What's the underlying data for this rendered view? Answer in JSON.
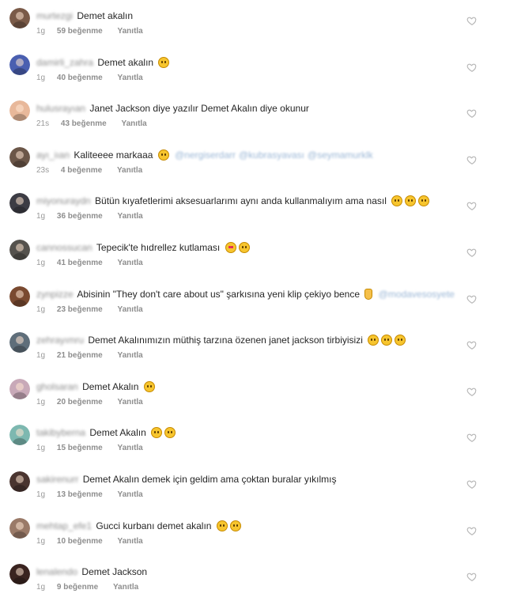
{
  "comments": [
    {
      "username": "murtezgi",
      "text": "Demet akalın",
      "emojis": [],
      "mentions": [],
      "time": "1g",
      "likes": "59 beğenme",
      "reply": "Yanıtla",
      "avatar_color": "#7a5a48"
    },
    {
      "username": "damirli_zahra",
      "text": "Demet akalın",
      "emojis": [
        "laugh"
      ],
      "mentions": [],
      "time": "1g",
      "likes": "40 beğenme",
      "reply": "Yanıtla",
      "avatar_color": "#4a5fb0"
    },
    {
      "username": "hulusrayıan",
      "text": "Janet Jackson diye yazılır Demet Akalın diye okunur",
      "emojis": [],
      "mentions": [],
      "time": "21s",
      "likes": "43 beğenme",
      "reply": "Yanıtla",
      "avatar_color": "#e8b89a"
    },
    {
      "username": "ayı_iıan",
      "text": "Kaliteeee markaaa",
      "emojis": [
        "laugh"
      ],
      "mentions": [
        "@nergiserdarr",
        "@kubrasyavası",
        "@seymamurklk"
      ],
      "time": "23s",
      "likes": "4 beğenme",
      "reply": "Yanıtla",
      "avatar_color": "#6b5648"
    },
    {
      "username": "miyonuraydn",
      "text": "Bütün kıyafetlerimi aksesuarlarımı aynı anda kullanmalıyım ama nasıl",
      "emojis": [
        "grin",
        "grin",
        "grin"
      ],
      "mentions": [],
      "time": "1g",
      "likes": "36 beğenme",
      "reply": "Yanıtla",
      "avatar_color": "#3c3c44"
    },
    {
      "username": "cannossucan",
      "text": "Tepecik'te hıdrellez kutlaması",
      "emojis": [
        "heart-eyes",
        "smile"
      ],
      "mentions": [],
      "time": "1g",
      "likes": "41 beğenme",
      "reply": "Yanıtla",
      "avatar_color": "#55524d"
    },
    {
      "username": "zynpizze",
      "text": "Abisinin \"They don't care about us\" şarkısına yeni klip çekiyo bence",
      "emojis": [
        "hand"
      ],
      "mentions": [
        "@modavesosyete"
      ],
      "time": "1g",
      "likes": "23 beğenme",
      "reply": "Yanıtla",
      "avatar_color": "#7a4a30"
    },
    {
      "username": "zehrayımru",
      "text": "Demet Akalınımızın müthiş tarzına özenen janet jackson tirbiyisizi",
      "emojis": [
        "laugh",
        "laugh",
        "laugh"
      ],
      "mentions": [],
      "time": "1g",
      "likes": "21 beğenme",
      "reply": "Yanıtla",
      "avatar_color": "#5f6e7a"
    },
    {
      "username": "gholsaran",
      "text": "Demet Akalın",
      "emojis": [
        "grin"
      ],
      "mentions": [],
      "time": "1g",
      "likes": "20 beğenme",
      "reply": "Yanıtla",
      "avatar_color": "#c8a9b8"
    },
    {
      "username": "takibyberna",
      "text": "Demet Akalın",
      "emojis": [
        "laugh",
        "laugh"
      ],
      "mentions": [],
      "time": "1g",
      "likes": "15 beğenme",
      "reply": "Yanıtla",
      "avatar_color": "#7db8b0"
    },
    {
      "username": "sakirenurr",
      "text": "Demet Akalın demek için geldim ama çoktan buralar yıkılmış",
      "emojis": [],
      "mentions": [],
      "time": "1g",
      "likes": "13 beğenme",
      "reply": "Yanıtla",
      "avatar_color": "#4a3530"
    },
    {
      "username": "mehtap_efe1",
      "text": "Gucci kurbanı demet akalın",
      "emojis": [
        "grin",
        "grin"
      ],
      "mentions": [],
      "time": "1g",
      "likes": "10 beğenme",
      "reply": "Yanıtla",
      "avatar_color": "#9a7a68"
    },
    {
      "username": "lenalendo",
      "text": "Demet Jackson",
      "emojis": [],
      "mentions": [],
      "time": "1g",
      "likes": "9 beğenme",
      "reply": "Yanıtla",
      "avatar_color": "#3a2420"
    }
  ]
}
